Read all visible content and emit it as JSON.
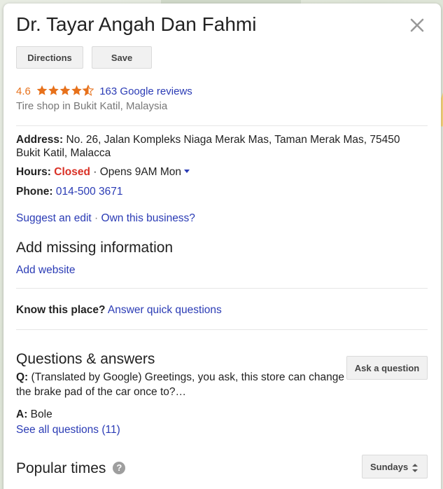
{
  "place": {
    "name": "Dr. Tayar Angah Dan Fahmi",
    "rating": "4.6",
    "reviews_link": "163 Google reviews",
    "category": "Tire shop in Bukit Katil, Malaysia"
  },
  "actions": {
    "directions_label": "Directions",
    "save_label": "Save"
  },
  "details": {
    "address_label": "Address:",
    "address_line1": "No. 26, Jalan Kompleks Niaga Merak Mas, Taman Merak Mas, 75450",
    "address_line2": "Bukit Katil, Malacca",
    "hours_label": "Hours:",
    "hours_status": "Closed",
    "hours_next": "· Opens 9AM Mon",
    "phone_label": "Phone:",
    "phone_value": "014-500 3671"
  },
  "edit_links": {
    "suggest_edit": "Suggest an edit",
    "separator": "·",
    "own_business": "Own this business?"
  },
  "missing_info": {
    "title": "Add missing information",
    "add_website": "Add website"
  },
  "know_place": {
    "label": "Know this place?",
    "link": "Answer quick questions"
  },
  "qa": {
    "title": "Questions & answers",
    "ask_button": "Ask a question",
    "q_label": "Q:",
    "question_line1": "(Translated by Google) Greetings, you ask, this store can change",
    "question_line2": "the brake pad of the car once to?…",
    "a_label": "A:",
    "answer": "Bole",
    "see_all": "See all questions (11)"
  },
  "popular_times": {
    "title": "Popular times",
    "help_glyph": "?",
    "day_select": "Sundays"
  },
  "colors": {
    "accent_link": "#2a3bb5",
    "rating_orange": "#e7711b",
    "closed_red": "#d93025"
  },
  "icons": {
    "close": "close-icon",
    "stars": "star-rating-icon",
    "hours_toggle": "caret-down-icon",
    "help": "help-circle-icon",
    "select_toggle": "up-down-arrows-icon"
  }
}
